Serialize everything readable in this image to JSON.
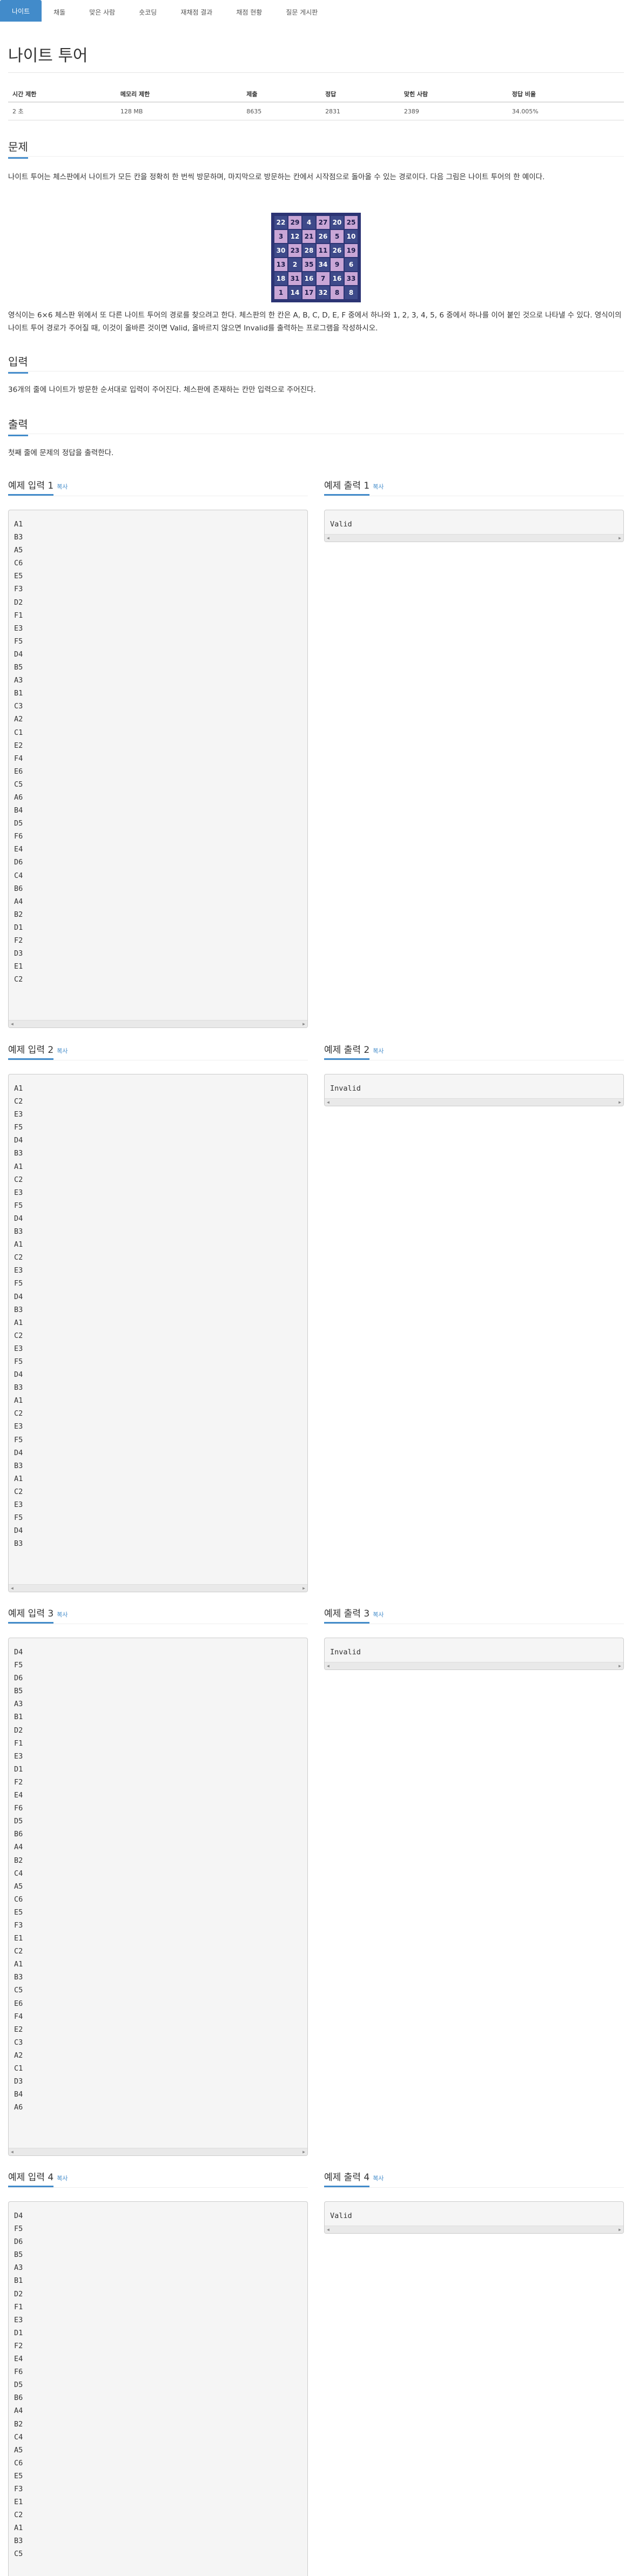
{
  "tabs": [
    "나이트",
    "채돌",
    "맞은 사람",
    "숏코딩",
    "재채점 결과",
    "채점 현황",
    "질문 게시판"
  ],
  "title": "나이트 투어",
  "info": {
    "headers": [
      "시간 제한",
      "메모리 제한",
      "제출",
      "정답",
      "맞힌 사람",
      "정답 비율"
    ],
    "values": [
      "2 초",
      "128 MB",
      "8635",
      "2831",
      "2389",
      "34.005%"
    ]
  },
  "problem": {
    "heading": "문제",
    "text1": "나이트 투어는 체스판에서 나이트가 모든 칸을 정확히 한 번씩 방문하며, 마지막으로 방문하는 칸에서 시작점으로 돌아올 수 있는 경로이다. 다음 그림은 나이트 투어의 한 예이다.",
    "text2": "영식이는 6×6 체스판 위에서 또 다른 나이트 투어의 경로를 찾으려고 한다. 체스판의 한 칸은 A, B, C, D, E, F 중에서 하나와 1, 2, 3, 4, 5, 6 중에서 하나를 이어 붙인 것으로 나타낼 수 있다. 영식이의 나이트 투어 경로가 주어질 때, 이것이 올바른 것이면 Valid, 올바르지 않으면 Invalid를 출력하는 프로그램을 작성하시오."
  },
  "board": [
    [
      "22",
      "29",
      "4",
      "27",
      "20",
      "25"
    ],
    [
      "3",
      "12",
      "21",
      "26",
      "5",
      "10"
    ],
    [
      "30",
      "23",
      "28",
      "11",
      "26",
      "19"
    ],
    [
      "13",
      "2",
      "35",
      "34",
      "9",
      "6"
    ],
    [
      "18",
      "31",
      "16",
      "7",
      "16",
      "33"
    ],
    [
      "1",
      "14",
      "17",
      "32",
      "8",
      "8"
    ]
  ],
  "input": {
    "heading": "입력",
    "text": "36개의 줄에 나이트가 방문한 순서대로 입력이 주어진다. 체스판에 존재하는 칸만 입력으로 주어진다."
  },
  "output": {
    "heading": "출력",
    "text": "첫째 줄에 문제의 정답을 출력한다."
  },
  "copy_label": "복사",
  "examples": [
    {
      "in_label": "예제 입력 1",
      "out_label": "예제 출력 1",
      "input": [
        "A1",
        "B3",
        "A5",
        "C6",
        "E5",
        "F3",
        "D2",
        "F1",
        "E3",
        "F5",
        "D4",
        "B5",
        "A3",
        "B1",
        "C3",
        "A2",
        "C1",
        "E2",
        "F4",
        "E6",
        "C5",
        "A6",
        "B4",
        "D5",
        "F6",
        "E4",
        "D6",
        "C4",
        "B6",
        "A4",
        "B2",
        "D1",
        "F2",
        "D3",
        "E1",
        "C2"
      ],
      "output": [
        "Valid"
      ]
    },
    {
      "in_label": "예제 입력 2",
      "out_label": "예제 출력 2",
      "input": [
        "A1",
        "C2",
        "E3",
        "F5",
        "D4",
        "B3",
        "A1",
        "C2",
        "E3",
        "F5",
        "D4",
        "B3",
        "A1",
        "C2",
        "E3",
        "F5",
        "D4",
        "B3",
        "A1",
        "C2",
        "E3",
        "F5",
        "D4",
        "B3",
        "A1",
        "C2",
        "E3",
        "F5",
        "D4",
        "B3",
        "A1",
        "C2",
        "E3",
        "F5",
        "D4",
        "B3"
      ],
      "output": [
        "Invalid"
      ]
    },
    {
      "in_label": "예제 입력 3",
      "out_label": "예제 출력 3",
      "input": [
        "D4",
        "F5",
        "D6",
        "B5",
        "A3",
        "B1",
        "D2",
        "F1",
        "E3",
        "D1",
        "F2",
        "E4",
        "F6",
        "D5",
        "B6",
        "A4",
        "B2",
        "C4",
        "A5",
        "C6",
        "E5",
        "F3",
        "E1",
        "C2",
        "A1",
        "B3",
        "C5",
        "E6",
        "F4",
        "E2",
        "C3",
        "A2",
        "C1",
        "D3",
        "B4",
        "A6"
      ],
      "output": [
        "Invalid"
      ]
    },
    {
      "in_label": "예제 입력 4",
      "out_label": "예제 출력 4",
      "input": [
        "D4",
        "F5",
        "D6",
        "B5",
        "A3",
        "B1",
        "D2",
        "F1",
        "E3",
        "D1",
        "F2",
        "E4",
        "F6",
        "D5",
        "B6",
        "A4",
        "B2",
        "C4",
        "A5",
        "C6",
        "E5",
        "F3",
        "E1",
        "C2",
        "A1",
        "B3",
        "C5"
      ],
      "output": [
        "Valid"
      ]
    }
  ]
}
